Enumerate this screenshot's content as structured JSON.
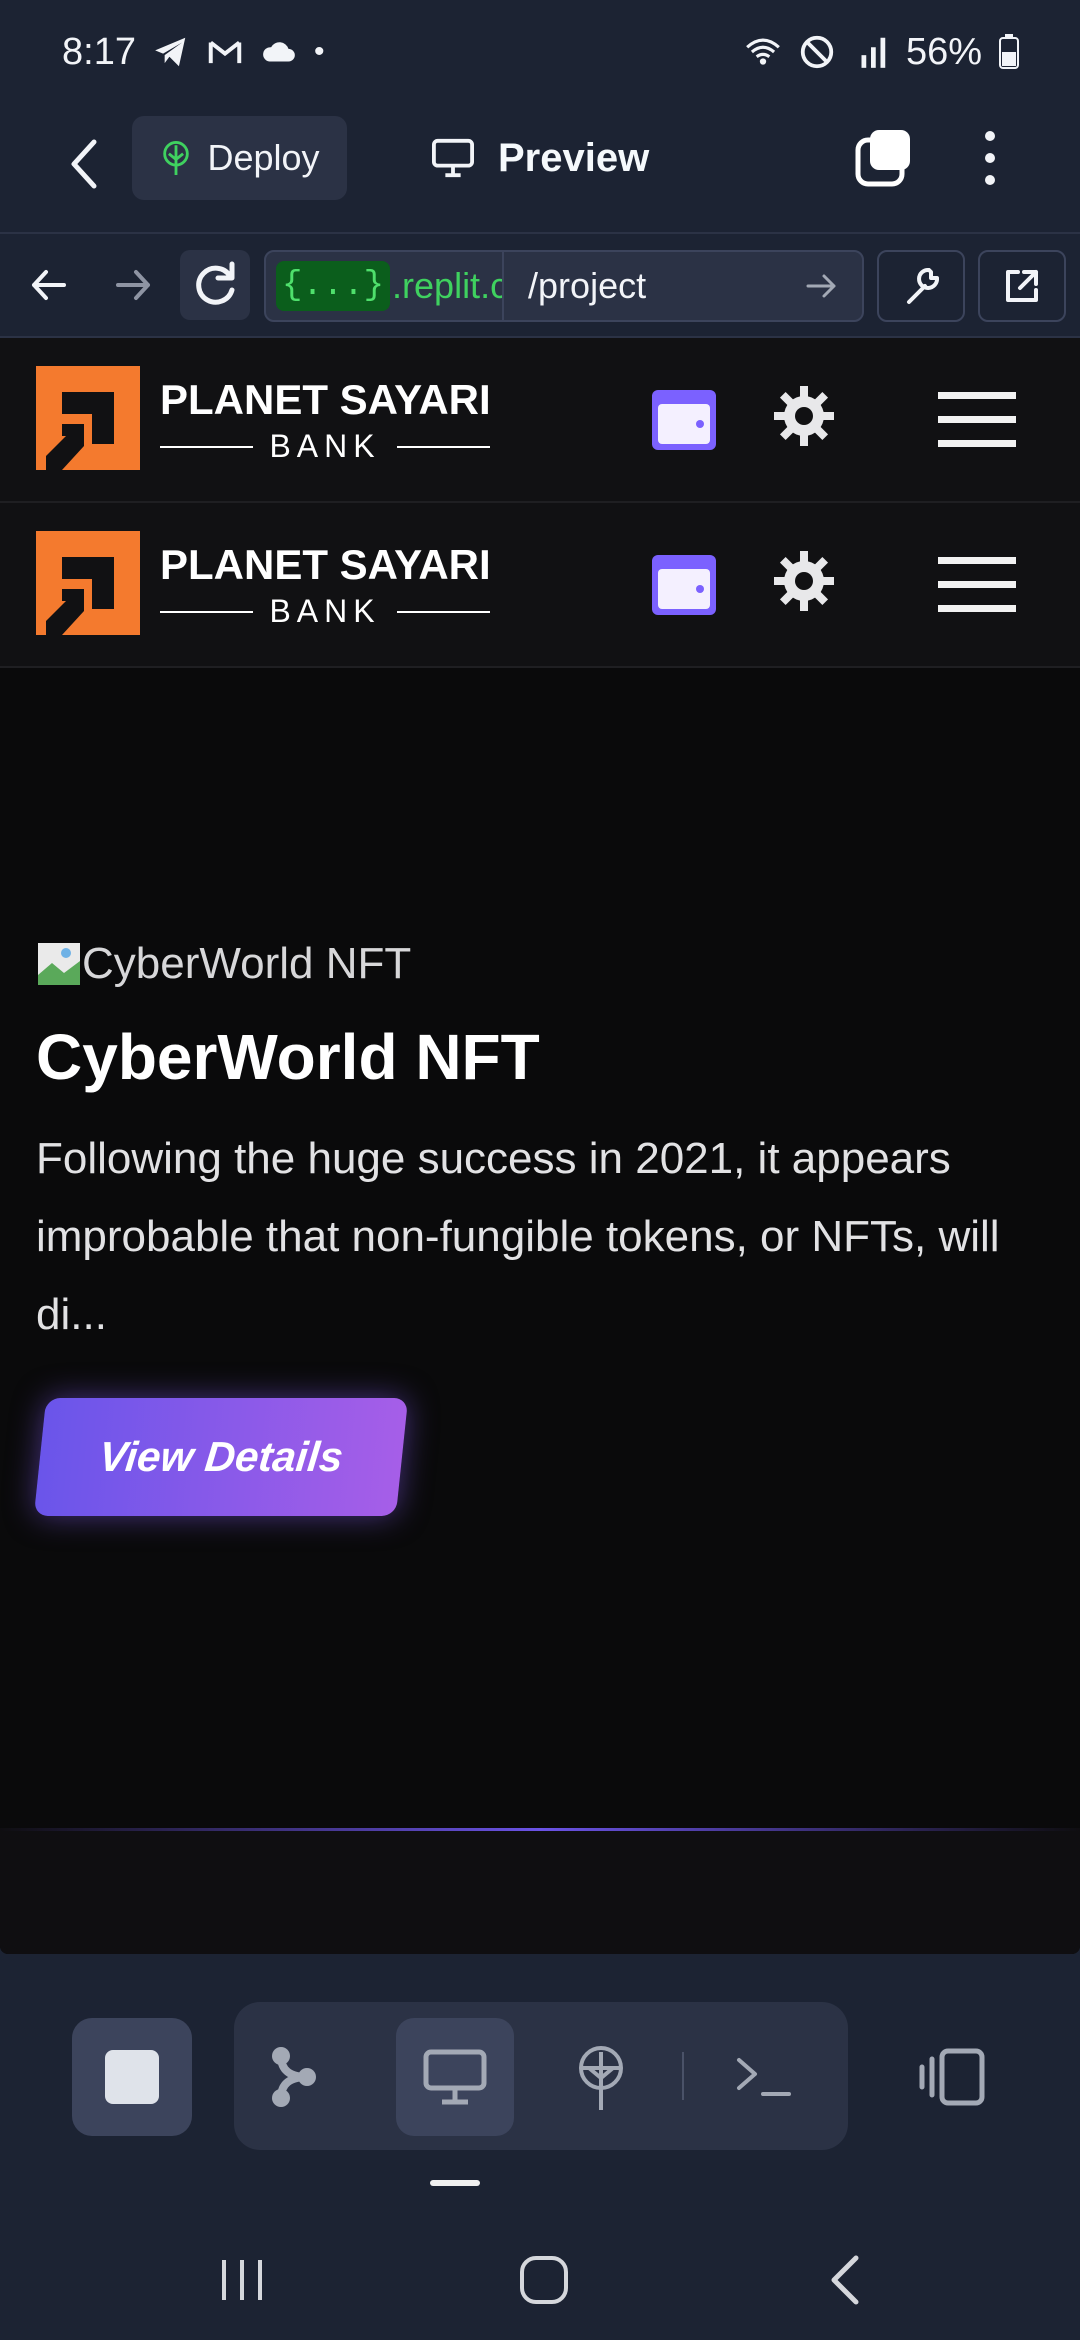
{
  "status_bar": {
    "time": "8:17",
    "battery": "56%",
    "dot": "•"
  },
  "replit_header": {
    "deploy_label": "Deploy",
    "preview_label": "Preview"
  },
  "browser": {
    "url_badge": "{...}",
    "url_domain": ".replit.c",
    "url_path": "/project"
  },
  "site": {
    "logo_title": "PLANET SAYARI",
    "logo_subtitle": "BANK",
    "accent_color": "#f47a2e",
    "wallet_color": "#7b61ff"
  },
  "card": {
    "image_alt": "CyberWorld NFT",
    "title": "CyberWorld NFT",
    "description": "Following the huge success in 2021, it appears improbable that non-fungible tokens, or NFTs, will di...",
    "button_label": "View Details"
  },
  "dock": {
    "icons": [
      "stop-icon",
      "git-icon",
      "preview-icon",
      "deploy-icon",
      "terminal-icon",
      "layout-icon"
    ]
  }
}
